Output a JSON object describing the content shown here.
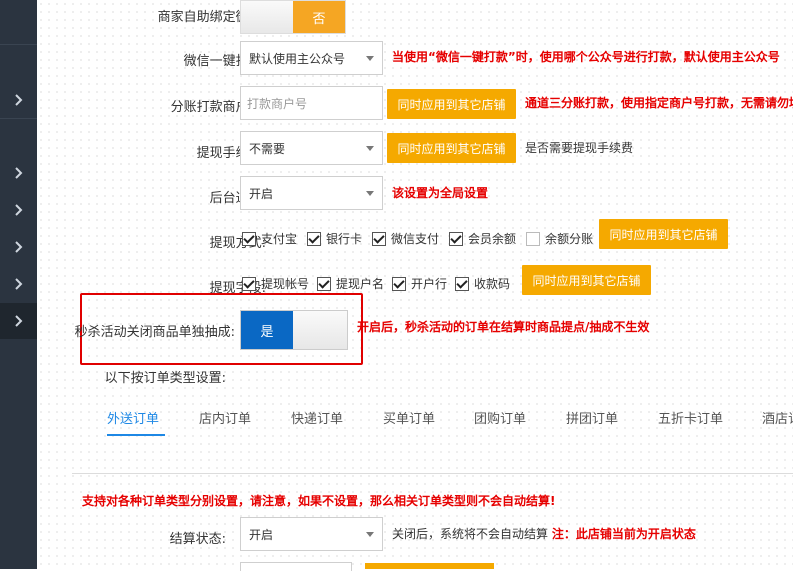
{
  "sidebar": {
    "rows": [
      "chevron-right",
      "chevron-right",
      "chevron-right",
      "chevron-right",
      "chevron-right",
      "chevron-right"
    ]
  },
  "form": {
    "merchant_bind_wechat": {
      "label": "商家自助绑定微信:",
      "toggle_off": "否"
    },
    "wechat_one_click": {
      "label": "微信一键打款:",
      "value": "默认使用主公众号",
      "note": "当使用“微信一键打款”时，使用哪个公众号进行打款，默认使用主公众号"
    },
    "split_merchant": {
      "label": "分账打款商户号:",
      "placeholder": "打款商户号",
      "apply_button": "同时应用到其它店铺",
      "note": "通道三分账打款，使用指定商户号打款，无需请勿填"
    },
    "withdraw_fee": {
      "label": "提现手续费:",
      "value": "不需要",
      "apply_button": "同时应用到其它店铺",
      "note": "是否需要提现手续费"
    },
    "backend_notify": {
      "label": "后台通知:",
      "value": "开启",
      "note": "该设置为全局设置"
    },
    "withdraw_methods": {
      "label": "提现方式:",
      "options": [
        {
          "name": "支付宝",
          "checked": true
        },
        {
          "name": "银行卡",
          "checked": true
        },
        {
          "name": "微信支付",
          "checked": true
        },
        {
          "name": "会员余额",
          "checked": true
        },
        {
          "name": "余额分账",
          "checked": false
        }
      ],
      "apply_button": "同时应用到其它店铺"
    },
    "withdraw_fields": {
      "label": "提现字段:",
      "options": [
        {
          "name": "提现帐号",
          "checked": true
        },
        {
          "name": "提现户名",
          "checked": true
        },
        {
          "name": "开户行",
          "checked": true
        },
        {
          "name": "收款码",
          "checked": true
        }
      ],
      "apply_button": "同时应用到其它店铺"
    },
    "flash_sale_commission": {
      "label": "秒杀活动关闭商品单独抽成:",
      "toggle_on": "是",
      "note": "开启后，秒杀活动的订单在结算时商品提点/抽成不生效"
    },
    "order_type_heading": "以下按订单类型设置:"
  },
  "tabs": {
    "items": [
      "外送订单",
      "店内订单",
      "快递订单",
      "买单订单",
      "团购订单",
      "拼团订单",
      "五折卡订单",
      "酒店订"
    ],
    "active": 0
  },
  "settlement": {
    "warning": "支持对各种订单类型分别设置，请注意，如果不设置，那么相关订单类型则不会自动结算!",
    "label": "结算状态:",
    "value": "开启",
    "note_plain": "关闭后，系统将不会自动结算",
    "note_red": "注：此店铺当前为开启状态"
  },
  "colors": {
    "accent_blue": "#0a68c4",
    "orange": "#f5a900",
    "red": "#e60000",
    "highlight_box": "#e00000",
    "tab_active": "#1e88e5"
  }
}
